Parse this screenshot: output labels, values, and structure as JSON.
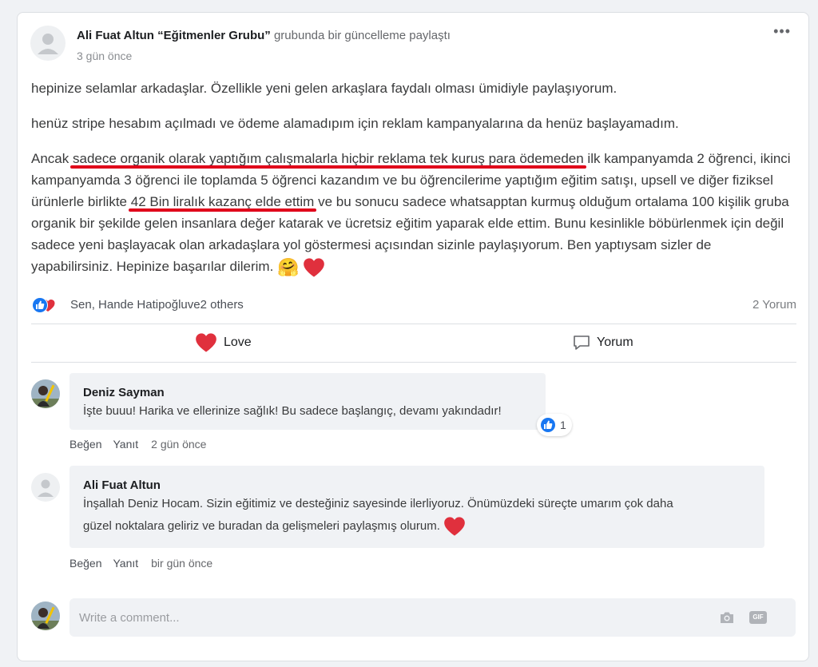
{
  "post": {
    "author": "Ali Fuat Altun",
    "group": "“Eğitmenler Grubu”",
    "activity": "grubunda bir güncelleme paylaştı",
    "time": "3 gün önce",
    "more": "•••",
    "para1": "hepinize selamlar arkadaşlar. Özellikle yeni gelen arkaşlara faydalı olması ümidiyle paylaşıyorum.",
    "para2": "henüz stripe hesabım açılmadı ve ödeme alamadıpım için reklam kampanyalarına da henüz başlayamadım.",
    "para3_a": "Ancak ",
    "para3_u1": "sadece organik olarak yaptığım çalışmalarla hiçbir reklama tek kuruş para ödemeden",
    "para3_b": " ilk kampanyamda 2 öğrenci, ikinci kampanyamda 3 öğrenci ile toplamda 5 öğrenci kazandım ve bu öğrencilerime yaptığım eğitim satışı, upsell ve diğer fiziksel ürünlerle birlikte ",
    "para3_u2": "42 Bin liralık kazanç elde ettim",
    "para3_c": " ve bu sonucu sadece whatsapptan kurmuş olduğum ortalama 100 kişilik gruba organik bir şekilde gelen insanlara değer katarak ve ücretsiz eğitim yaparak elde ettim. Bunu kesinlikle böbürlenmek için değil sadece yeni başlayacak olan arkadaşlara yol göstermesi açısından sizinle paylaşıyorum. Ben yaptıysam sizler de yapabilirsiniz. Hepinize başarılar dilerim.",
    "para3_emoji": "🤗"
  },
  "reactions": {
    "names": "Sen, Hande Hatipoğluve2 others",
    "comment_count": "2 Yorum"
  },
  "actions": {
    "love": "Love",
    "comment": "Yorum"
  },
  "comments": [
    {
      "name": "Deniz Sayman",
      "text": "İşte buuu! Harika ve ellerinize sağlık! Bu sadece başlangıç, devamı yakındadır!",
      "like": "Beğen",
      "reply": "Yanıt",
      "time": "2 gün önce",
      "like_count": "1"
    },
    {
      "name": "Ali Fuat Altun",
      "text_line1": "İnşallah Deniz Hocam. Sizin eğitimiz ve desteğiniz sayesinde ilerliyoruz. Önümüzdeki süreçte umarım çok daha",
      "text_line2": "güzel noktalara geliriz ve buradan da gelişmeleri paylaşmış olurum.",
      "like": "Beğen",
      "reply": "Yanıt",
      "time": "bir gün önce"
    }
  ],
  "composer": {
    "placeholder": "Write a comment...",
    "gif_label": "GIF"
  },
  "colors": {
    "heart": "#e0303d",
    "like_blue": "#1877f2",
    "underline": "#e0001a"
  }
}
